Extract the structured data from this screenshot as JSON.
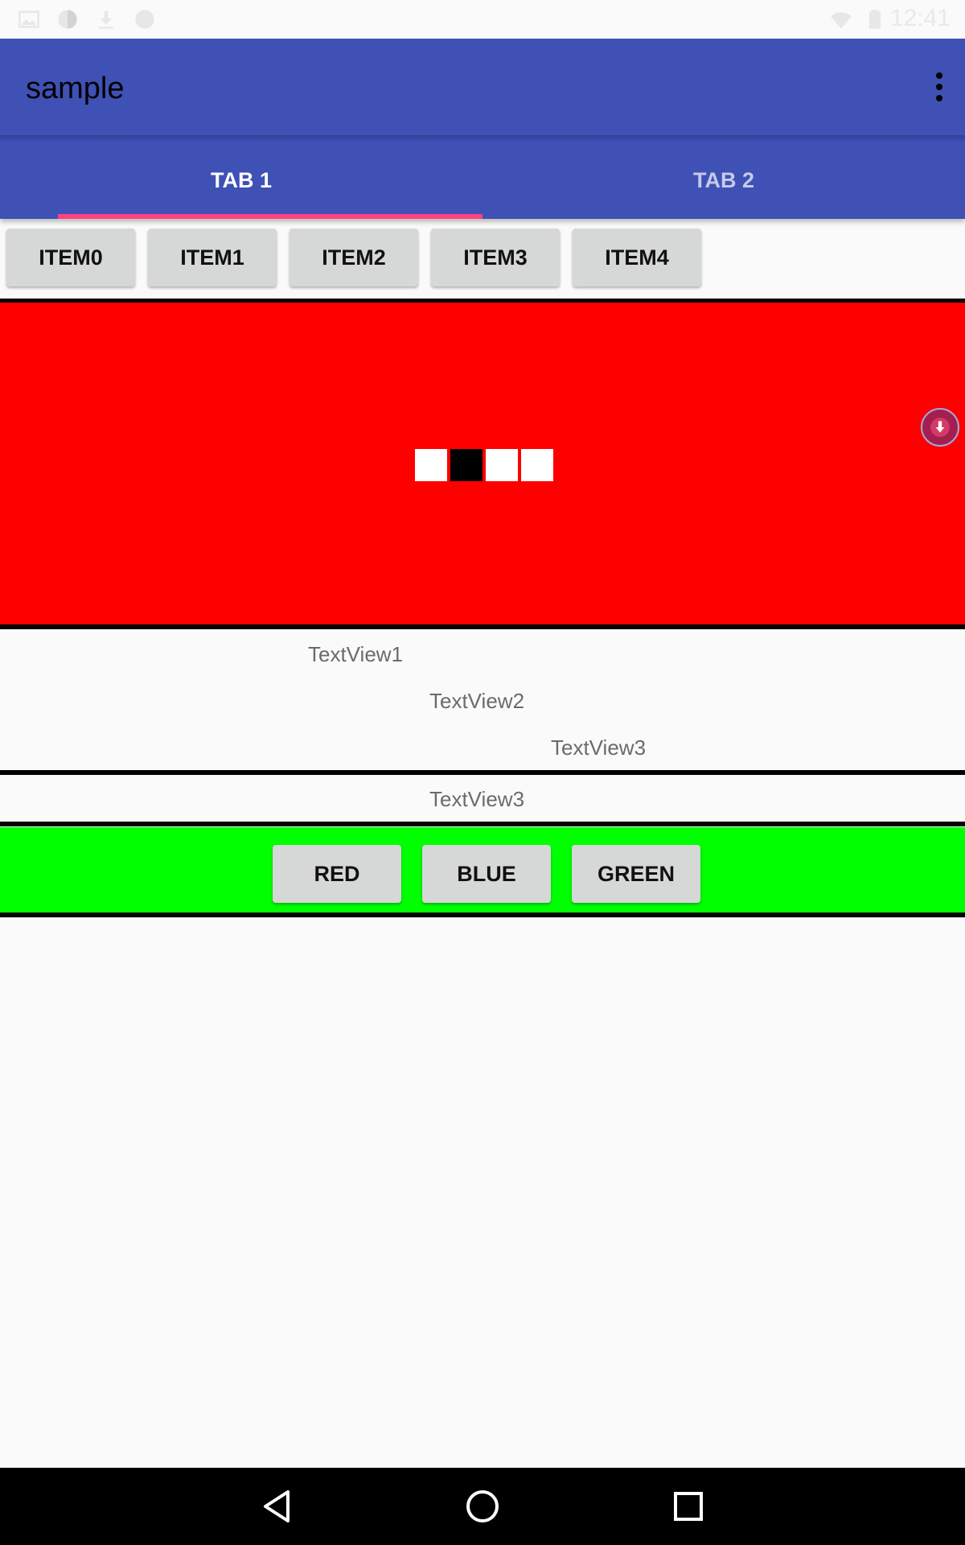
{
  "status_bar": {
    "time": "12:41",
    "left_icons": [
      "image-icon",
      "data-saver-icon",
      "download-icon",
      "circle-icon"
    ],
    "right_icons": [
      "wifi-icon",
      "battery-icon"
    ]
  },
  "toolbar": {
    "title": "sample",
    "overflow_icon": "more-vert-icon"
  },
  "tabs": [
    {
      "label": "TAB 1",
      "selected": true
    },
    {
      "label": "TAB 2",
      "selected": false
    }
  ],
  "item_buttons": [
    "ITEM0",
    "ITEM1",
    "ITEM2",
    "ITEM3",
    "ITEM4"
  ],
  "red_panel": {
    "background": "#ff0000",
    "page_indicator": {
      "count": 4,
      "active_index": 1
    },
    "fab_icon": "arrow-down-circle-icon"
  },
  "text_views": [
    "TextView1",
    "TextView2",
    "TextView3"
  ],
  "center_text": "TextView3",
  "color_buttons": [
    "RED",
    "BLUE",
    "GREEN"
  ],
  "colors": {
    "primary": "#3f51b5",
    "accent": "#ff4081",
    "red_panel": "#ff0000",
    "green_panel": "#00ff00",
    "button": "#d6d7d7"
  },
  "nav_bar": [
    "back-icon",
    "home-icon",
    "recents-icon"
  ]
}
